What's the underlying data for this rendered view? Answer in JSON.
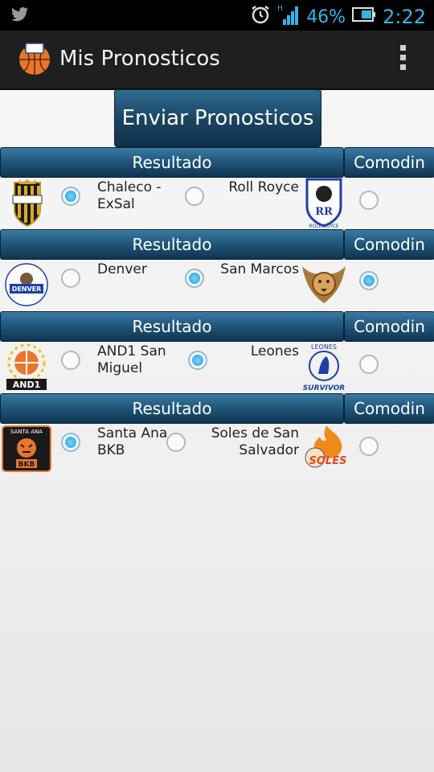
{
  "status_bar": {
    "battery": "46%",
    "time": "2:22",
    "network": "H"
  },
  "app": {
    "title": "Mis Pronosticos"
  },
  "send_button": "Enviar Pronosticos",
  "matches": [
    {
      "result_label": "Resultado",
      "comodin_label": "Comodin",
      "home": {
        "name": "Chaleco - ExSal",
        "logo": "shield-logo"
      },
      "away": {
        "name": "Roll Royce",
        "logo": "roll-royce-logo"
      },
      "pick": "home",
      "comodin": false
    },
    {
      "result_label": "Resultado",
      "comodin_label": "Comodin",
      "home": {
        "name": "Denver",
        "logo": "denver-logo"
      },
      "away": {
        "name": "San Marcos",
        "logo": "lion-logo"
      },
      "pick": "away",
      "comodin": true
    },
    {
      "result_label": "Resultado",
      "comodin_label": "Comodin",
      "home": {
        "name": "AND1 San Miguel",
        "logo": "and1-logo"
      },
      "away": {
        "name": "Leones",
        "logo": "leones-survivor-logo"
      },
      "pick": "away",
      "comodin": false
    },
    {
      "result_label": "Resultado",
      "comodin_label": "Comodin",
      "home": {
        "name": "Santa Ana BKB",
        "logo": "tiger-logo"
      },
      "away": {
        "name": "Soles de San Salvador",
        "logo": "soles-logo"
      },
      "pick": "home",
      "comodin": false
    }
  ],
  "logo_text": {
    "roll_royce": "RR",
    "roll_royce_caption": "ROLL ROYCE",
    "denver": "DENVER",
    "and1": "AND1",
    "leones_top": "LEONES",
    "leones_bottom": "SURVIVOR",
    "santa_ana": "SANTA ANA",
    "bkb": "BKB",
    "soles": "SOLES"
  }
}
